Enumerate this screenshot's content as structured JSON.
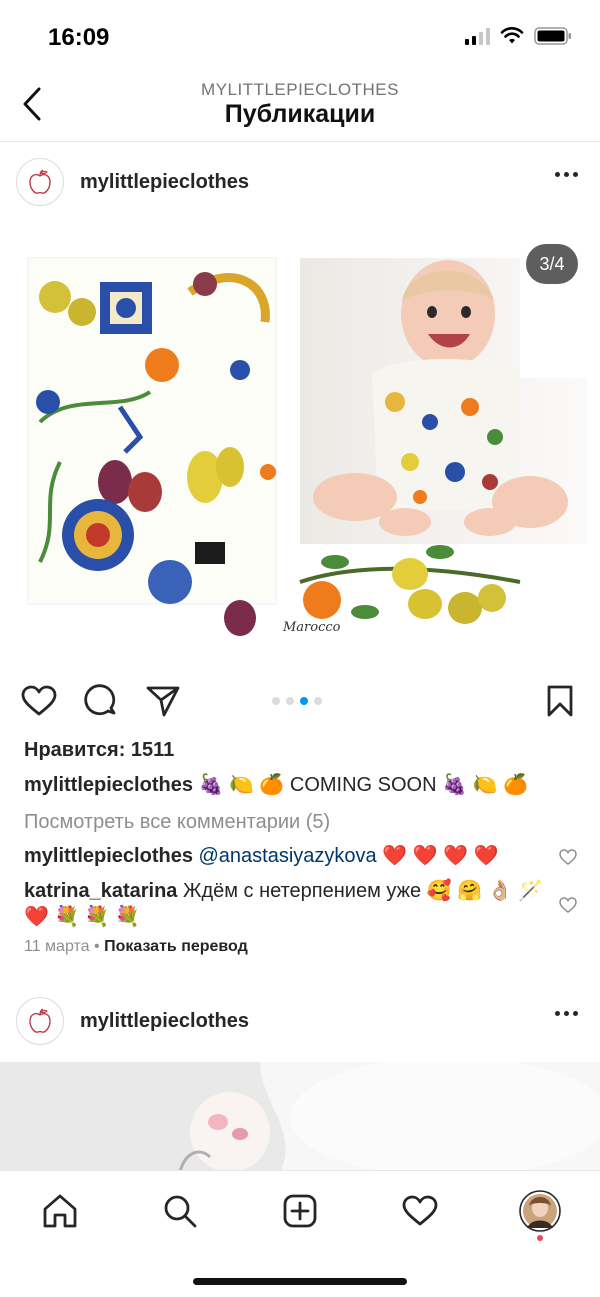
{
  "status_bar": {
    "time": "16:09"
  },
  "header": {
    "subtitle": "MYLITTLEPIECLOTHES",
    "title": "Публикации"
  },
  "post": {
    "username": "mylittlepieclothes",
    "counter": "3/4",
    "image_caption": "Marocco",
    "carousel": {
      "total": 4,
      "active_index": 2
    },
    "likes": "Нравится: 1511",
    "caption": {
      "user": "mylittlepieclothes",
      "text": "🍇 🍋 🍊 COMING SOON 🍇 🍋 🍊"
    },
    "view_comments": "Посмотреть все комментарии (5)",
    "comments": [
      {
        "user": "mylittlepieclothes",
        "mention": "@anastasiyazykova",
        "text": "❤️ ❤️ ❤️ ❤️"
      },
      {
        "user": "katrina_katarina",
        "text": "Ждём с нетерпением уже 🥰 🤗 👌🏼 🪄 ❤️ 💐 💐 💐"
      }
    ],
    "date": "11 марта",
    "separator": "•",
    "translate": "Показать перевод"
  },
  "post2": {
    "username": "mylittlepieclothes"
  },
  "icons": {
    "back": "chevron-left-icon",
    "more": "more-icon",
    "like": "heart-icon",
    "comment": "comment-icon",
    "share": "send-icon",
    "save": "bookmark-icon",
    "home": "home-icon",
    "search": "search-icon",
    "create": "add-icon",
    "activity": "heart-icon",
    "profile": "profile-avatar"
  },
  "colors": {
    "accent": "#0095f6",
    "link": "#00376b",
    "muted": "#8e8e8e",
    "notification": "#ed4956"
  }
}
